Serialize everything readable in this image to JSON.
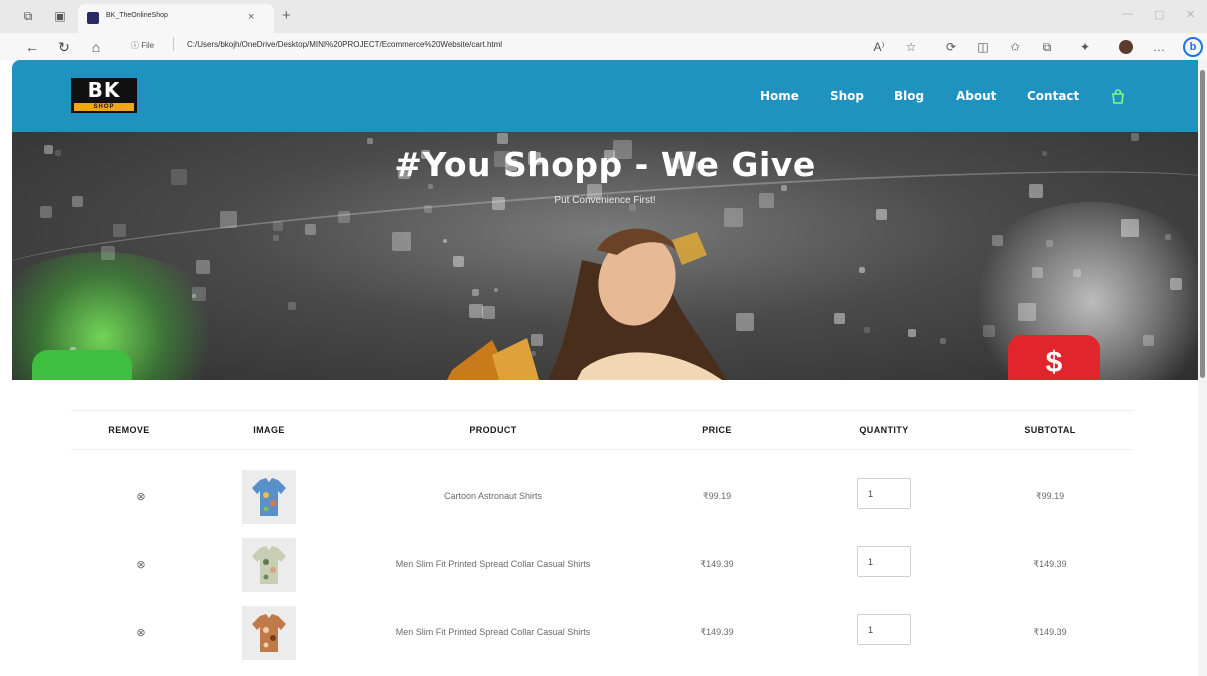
{
  "browser": {
    "tab_title": "BK_TheOnlineShop",
    "url_info": "ⓘ File",
    "url": "C:/Users/bkojh/OneDrive/Desktop/MINI%20PROJECT/Ecommerce%20Website/cart.html",
    "read_aloud_label": "A⁾"
  },
  "site": {
    "logo_top": "BK",
    "logo_bottom": "SHOP",
    "nav": [
      "Home",
      "Shop",
      "Blog",
      "About",
      "Contact"
    ],
    "accent_color": "#1f92bf",
    "cart_icon_color": "#7CFC7C"
  },
  "hero": {
    "title": "#You Shopp - We Give",
    "subtitle": "Put Convenience First!"
  },
  "cart": {
    "headers": [
      "REMOVE",
      "IMAGE",
      "PRODUCT",
      "PRICE",
      "QUANTITY",
      "SUBTOTAL"
    ],
    "rows": [
      {
        "product": "Cartoon Astronaut Shirts",
        "price": "₹99.19",
        "quantity": "1",
        "subtotal": "₹99.19",
        "thumb_color": "#5a8fc9"
      },
      {
        "product": "Men Slim Fit Printed Spread Collar Casual Shirts",
        "price": "₹149.39",
        "quantity": "1",
        "subtotal": "₹149.39",
        "thumb_color": "#9aa88a"
      },
      {
        "product": "Men Slim Fit Printed Spread Collar Casual Shirts",
        "price": "₹149.39",
        "quantity": "1",
        "subtotal": "₹149.39",
        "thumb_color": "#b86a3a"
      }
    ]
  }
}
